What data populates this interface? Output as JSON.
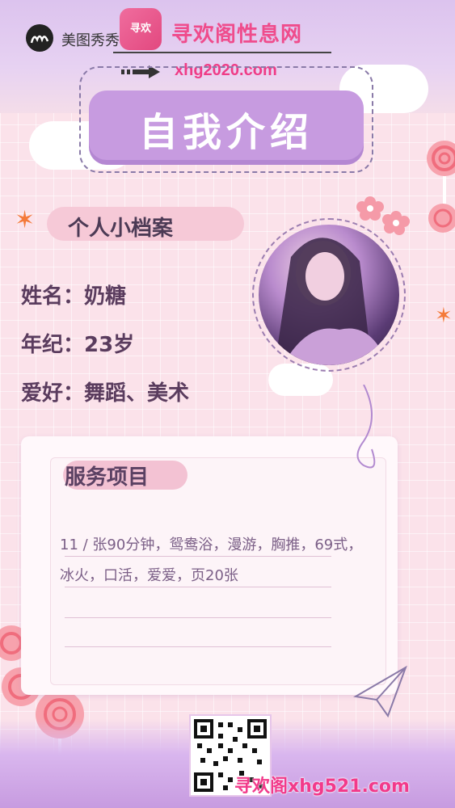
{
  "watermark": {
    "app_name": "美图秀秀",
    "site_logo_text": "寻欢",
    "site_title": "寻欢阁性息网",
    "site_url": "xhg2020.com",
    "bottom_text": "寻欢阁xhg521.com"
  },
  "header": {
    "title": "自我介绍"
  },
  "profile": {
    "section_title": "个人小档案",
    "name_line": "姓名：奶糖",
    "age_line": "年纪：23岁",
    "hobby_line": "爱好：舞蹈、美术"
  },
  "services": {
    "section_title": "服务项目",
    "lines": [
      "11 / 张90分钟，鸳鸯浴，漫游，胸推，69式，",
      "冰火，口活，爱爱，页20张"
    ]
  },
  "colors": {
    "accent_purple": "#c79be0",
    "accent_pink": "#ef4c8c",
    "background": "#fbe2ea"
  }
}
